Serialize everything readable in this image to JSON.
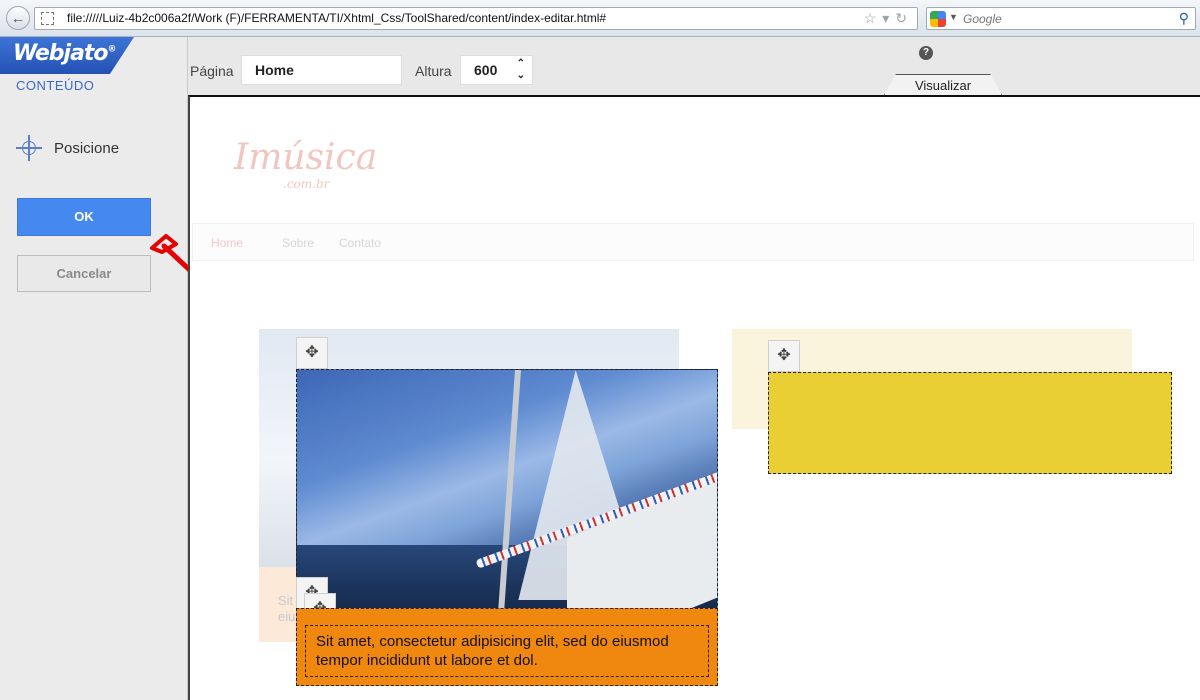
{
  "browser": {
    "url": "file://///Luiz-4b2c006a2f/Work  (F)/FERRAMENTA/TI/Xhtml_Css/ToolShared/content/index-editar.html#",
    "search_placeholder": "Google"
  },
  "sidebar": {
    "brand": "Webjato",
    "brand_mark": "®",
    "section_title": "CONTEÚDO",
    "position_label": "Posicione",
    "ok_label": "OK",
    "cancel_label": "Cancelar"
  },
  "toolbar": {
    "page_label": "Página",
    "page_value": "Home",
    "height_label": "Altura",
    "height_value": "600",
    "help_glyph": "?",
    "preview_tab": "Visualizar"
  },
  "site": {
    "logo": "Imúsica",
    "logo_sub": ".com.br",
    "nav": [
      "Home",
      "Sobre",
      "Contato"
    ],
    "ghost_caption": "Sit\neiu",
    "caption": "Sit amet, consectetur adipisicing elit, sed do eiusmod tempor incididunt ut  labore et dol."
  },
  "colors": {
    "accent": "#4588f0",
    "caption_bg": "#f0880f",
    "yellow_block": "#e9cf33",
    "arrow": "#e60000"
  },
  "icons": {
    "move": "move-icon",
    "crosshair": "crosshair-icon",
    "help": "help-icon"
  }
}
